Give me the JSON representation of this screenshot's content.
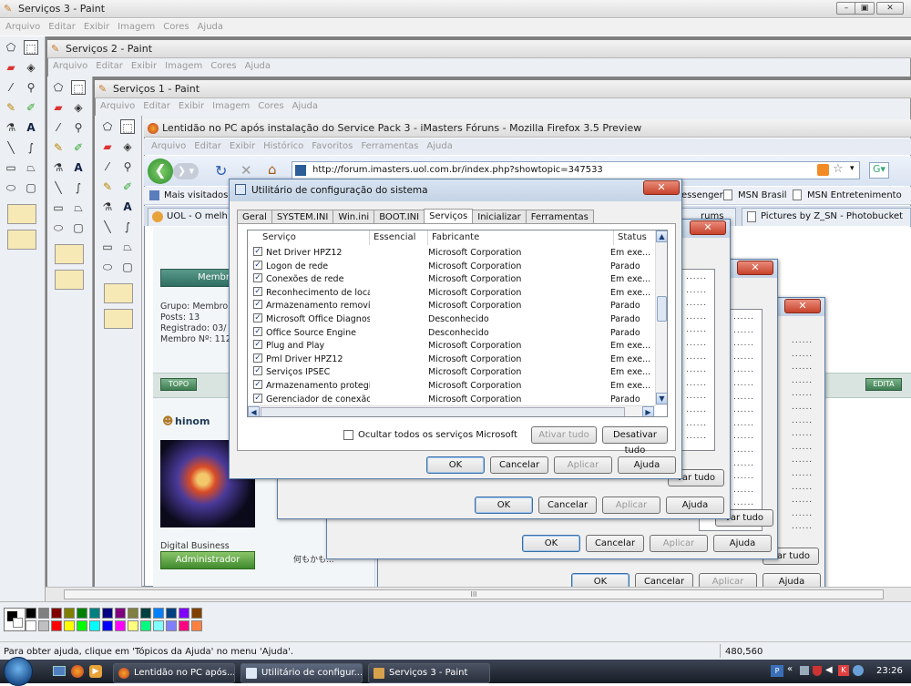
{
  "paint3": {
    "title": "Serviços 3 - Paint",
    "menu": [
      "Arquivo",
      "Editar",
      "Exibir",
      "Imagem",
      "Cores",
      "Ajuda"
    ],
    "status_help": "Para obter ajuda, clique em 'Tópicos da Ajuda' no menu 'Ajuda'.",
    "status_coords": "480,560"
  },
  "paint2": {
    "title": "Serviços 2 - Paint",
    "menu": [
      "Arquivo",
      "Editar",
      "Exibir",
      "Imagem",
      "Cores",
      "Ajuda"
    ]
  },
  "paint1": {
    "title": "Serviços 1 - Paint",
    "menu": [
      "Arquivo",
      "Editar",
      "Exibir",
      "Imagem",
      "Cores",
      "Ajuda"
    ]
  },
  "firefox": {
    "title": "Lentidão no PC após instalação do Service Pack 3 - iMasters Fóruns - Mozilla Firefox 3.5 Preview",
    "menu": [
      "Arquivo",
      "Editar",
      "Exibir",
      "Histórico",
      "Favoritos",
      "Ferramentas",
      "Ajuda"
    ],
    "url": "http://forum.imasters.uol.com.br/index.php?showtopic=347533",
    "bookmarks": [
      "Mais visitados",
      "essenger",
      "MSN Brasil",
      "MSN Entretenimento"
    ],
    "tabs": [
      "UOL - O melh",
      "rums",
      "Pictures by Z_SN - Photobucket"
    ],
    "forum": {
      "member_badge": "Membro",
      "group": "Grupo: Membro",
      "posts": "Posts: 13",
      "registered": "Registrado: 03/",
      "member_no": "Membro Nº: 112",
      "topo": "TOPO",
      "edit": "EDITA",
      "username": "hinom",
      "company": "Digital Business",
      "role_badge": "Administrador",
      "jp_text": "何もかも..."
    }
  },
  "msconfig": {
    "title": "Utilitário de configuração do sistema",
    "tabs": [
      "Geral",
      "SYSTEM.INI",
      "Win.ini",
      "BOOT.INI",
      "Serviços",
      "Inicializar",
      "Ferramentas"
    ],
    "active_tab": "Serviços",
    "columns": [
      "Serviço",
      "Essencial",
      "Fabricante",
      "Status"
    ],
    "services": [
      {
        "name": "Net Driver HPZ12",
        "maker": "Microsoft Corporation",
        "status": "Em exe..."
      },
      {
        "name": "Logon de rede",
        "maker": "Microsoft Corporation",
        "status": "Parado"
      },
      {
        "name": "Conexões de rede",
        "maker": "Microsoft Corporation",
        "status": "Em exe..."
      },
      {
        "name": "Reconhecimento de local...",
        "maker": "Microsoft Corporation",
        "status": "Em exe..."
      },
      {
        "name": "Armazenamento removível",
        "maker": "Microsoft Corporation",
        "status": "Parado"
      },
      {
        "name": "Microsoft Office Diagnos...",
        "maker": "Desconhecido",
        "status": "Parado"
      },
      {
        "name": "Office Source Engine",
        "maker": "Desconhecido",
        "status": "Parado"
      },
      {
        "name": "Plug and Play",
        "maker": "Microsoft Corporation",
        "status": "Em exe..."
      },
      {
        "name": "Pml Driver HPZ12",
        "maker": "Microsoft Corporation",
        "status": "Em exe..."
      },
      {
        "name": "Serviços IPSEC",
        "maker": "Microsoft Corporation",
        "status": "Em exe..."
      },
      {
        "name": "Armazenamento protegido",
        "maker": "Microsoft Corporation",
        "status": "Em exe..."
      },
      {
        "name": "Gerenciador de conexão...",
        "maker": "Microsoft Corporation",
        "status": "Parado"
      }
    ],
    "hide_ms": "Ocultar todos os serviços Microsoft",
    "enable_all": "Ativar tudo",
    "disable_all": "Desativar tudo",
    "ok": "OK",
    "cancel": "Cancelar",
    "apply": "Aplicar",
    "help": "Ajuda"
  },
  "ghost_dialogs": {
    "disable_all_partial": "var tudo",
    "ok": "OK",
    "cancel": "Cancelar",
    "apply": "Aplicar",
    "help": "Ajuda"
  },
  "taskbar": {
    "items": [
      "Lentidão no PC após...",
      "Utilitário de configur...",
      "Serviços 3 - Paint"
    ],
    "clock": "23:26"
  },
  "colors": {
    "palette": [
      "#000000",
      "#808080",
      "#800000",
      "#808000",
      "#008000",
      "#008080",
      "#000080",
      "#800080",
      "#808040",
      "#004040",
      "#0080ff",
      "#004080",
      "#8000ff",
      "#804000",
      "#ffffff",
      "#c0c0c0",
      "#ff0000",
      "#ffff00",
      "#00ff00",
      "#00ffff",
      "#0000ff",
      "#ff00ff",
      "#ffff80",
      "#00ff80",
      "#80ffff",
      "#8080ff",
      "#ff0080",
      "#ff8040"
    ]
  }
}
